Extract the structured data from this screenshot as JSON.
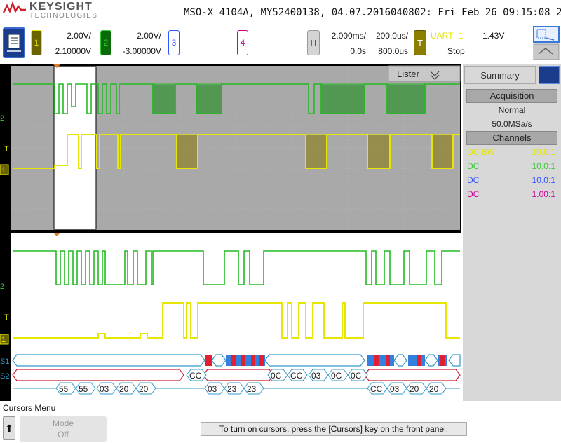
{
  "header": {
    "brand": "KEYSIGHT",
    "brand_sub": "TECHNOLOGIES",
    "info": "MSO-X 4104A, MY52400138, 04.07.2016040802: Fri Feb 26 09:15:08 2021"
  },
  "channels": [
    {
      "num": "1",
      "scale": "2.00V/",
      "offset": "2.10000V",
      "color": "#e6e600",
      "box_bg": "#6b6200"
    },
    {
      "num": "2",
      "scale": "2.00V/",
      "offset": "-3.00000V",
      "color": "#33cc33",
      "box_bg": "#0a6a0a"
    },
    {
      "num": "3",
      "scale": "",
      "offset": "",
      "color": "#3355ff"
    },
    {
      "num": "4",
      "scale": "",
      "offset": "",
      "color": "#cc0099"
    }
  ],
  "horizontal": {
    "label": "H",
    "time_div": "2.000ms/",
    "delay": "0.0s",
    "zoom_div": "200.0us/",
    "zoom_delay": "800.0us"
  },
  "trigger": {
    "label": "T",
    "type": "UART",
    "source": "1",
    "level": "1.43V",
    "state": "Stop"
  },
  "lister_label": "Lister",
  "summary": {
    "tab": "Summary",
    "acquisition_heading": "Acquisition",
    "mode": "Normal",
    "rate": "50.0MSa/s",
    "channels_heading": "Channels",
    "rows": [
      {
        "coupling": "DC BW",
        "probe": "10.0:1",
        "color": "#e6e600"
      },
      {
        "coupling": "DC",
        "probe": "10.0:1",
        "color": "#33cc33"
      },
      {
        "coupling": "DC",
        "probe": "10.0:1",
        "color": "#3355ff"
      },
      {
        "coupling": "DC",
        "probe": "1.00:1",
        "color": "#cc0099"
      }
    ]
  },
  "markers": {
    "ch2": "2",
    "ch1": "1",
    "trig": "T",
    "s1": "S1",
    "s2": "S2"
  },
  "decode": {
    "s2_bytes": [
      "55",
      "55",
      "03",
      "20",
      "20",
      "03",
      "23",
      "23",
      "03",
      "20",
      "20"
    ],
    "s1_bytes": [
      "CC",
      "0C",
      "CC",
      "03",
      "0C",
      "0C",
      "CC"
    ]
  },
  "bottom": {
    "cursors_menu": "Cursors Menu",
    "mode_label": "Mode",
    "mode_value": "Off",
    "status": "To turn on cursors, press the [Cursors] key on the front panel."
  },
  "colors": {
    "ch1": "#e6e600",
    "ch2": "#33cc33",
    "decode_s1": "#2266dd",
    "decode_s2": "#cc2233"
  }
}
